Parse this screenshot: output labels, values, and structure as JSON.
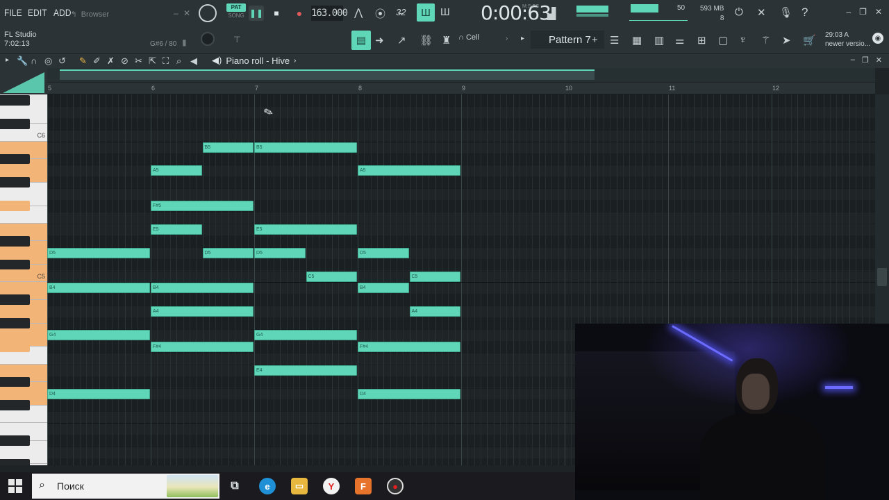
{
  "menu": {
    "file": "FILE",
    "edit": "EDIT",
    "add": "ADD"
  },
  "browser_hint": "Browser",
  "app": {
    "name": "FL Studio",
    "time": "7:02:13"
  },
  "note_info": "G#6 / 80",
  "transport": {
    "pat": "PAT",
    "song": "SONG",
    "tempo": "163.000",
    "time": "0:00:63",
    "time_label": "M:S:CS"
  },
  "status": {
    "cpu": "50",
    "memory": "593 MB",
    "polyphony": "8"
  },
  "toolbar2": {
    "cell": "Cell",
    "pattern": "Pattern 7",
    "news_time": "29:03",
    "news_letter": "A",
    "news_text": "newer versio..."
  },
  "piano_roll": {
    "title": "Piano roll - Hive"
  },
  "ruler": {
    "bars": [
      {
        "label": "5",
        "pos": 0
      },
      {
        "label": "6",
        "pos": 1
      },
      {
        "label": "7",
        "pos": 2
      },
      {
        "label": "8",
        "pos": 3
      },
      {
        "label": "9",
        "pos": 4
      },
      {
        "label": "10",
        "pos": 5
      },
      {
        "label": "11",
        "pos": 6
      },
      {
        "label": "12",
        "pos": 7
      }
    ]
  },
  "keyboard": {
    "c6": "C6",
    "c5": "C5"
  },
  "notes": [
    {
      "label": "B5",
      "pitch": "B5",
      "start": 1.5,
      "len": 0.5
    },
    {
      "label": "B5",
      "pitch": "B5",
      "start": 2.0,
      "len": 1.0
    },
    {
      "label": "A5",
      "pitch": "A5",
      "start": 1.0,
      "len": 0.5
    },
    {
      "label": "A5",
      "pitch": "A5",
      "start": 3.0,
      "len": 1.0
    },
    {
      "label": "F#5",
      "pitch": "F#5",
      "start": 1.0,
      "len": 1.0
    },
    {
      "label": "E5",
      "pitch": "E5",
      "start": 1.0,
      "len": 0.5
    },
    {
      "label": "E5",
      "pitch": "E5",
      "start": 2.0,
      "len": 1.0
    },
    {
      "label": "D5",
      "pitch": "D5",
      "start": 0.0,
      "len": 1.0
    },
    {
      "label": "D5",
      "pitch": "D5",
      "start": 1.5,
      "len": 0.5
    },
    {
      "label": "D5",
      "pitch": "D5",
      "start": 2.0,
      "len": 0.5
    },
    {
      "label": "D5",
      "pitch": "D5",
      "start": 3.0,
      "len": 0.5
    },
    {
      "label": "C5",
      "pitch": "C5",
      "start": 2.5,
      "len": 0.5
    },
    {
      "label": "C5",
      "pitch": "C5",
      "start": 3.5,
      "len": 0.5
    },
    {
      "label": "B4",
      "pitch": "B4",
      "start": 0.0,
      "len": 1.0
    },
    {
      "label": "B4",
      "pitch": "B4",
      "start": 1.0,
      "len": 1.0
    },
    {
      "label": "B4",
      "pitch": "B4",
      "start": 3.0,
      "len": 0.5
    },
    {
      "label": "A4",
      "pitch": "A4",
      "start": 1.0,
      "len": 1.0
    },
    {
      "label": "A4",
      "pitch": "A4",
      "start": 3.5,
      "len": 0.5
    },
    {
      "label": "G4",
      "pitch": "G4",
      "start": 0.0,
      "len": 1.0
    },
    {
      "label": "G4",
      "pitch": "G4",
      "start": 2.0,
      "len": 1.0
    },
    {
      "label": "F#4",
      "pitch": "F#4",
      "start": 1.0,
      "len": 1.0
    },
    {
      "label": "F#4",
      "pitch": "F#4",
      "start": 3.0,
      "len": 1.0
    },
    {
      "label": "E4",
      "pitch": "E4",
      "start": 2.0,
      "len": 1.0
    },
    {
      "label": "D4",
      "pitch": "D4",
      "start": 0.0,
      "len": 1.0
    },
    {
      "label": "D4",
      "pitch": "D4",
      "start": 3.0,
      "len": 1.0
    }
  ],
  "taskbar": {
    "search_placeholder": "Поиск"
  },
  "colors": {
    "accent": "#5fd6b8",
    "highlight_key": "#f2b477",
    "background": "#1f2527"
  },
  "icons": [
    "windows-start-icon",
    "search-icon",
    "task-view-icon",
    "edge-icon",
    "file-explorer-icon",
    "yandex-icon",
    "fl-studio-icon",
    "recorder-icon"
  ]
}
